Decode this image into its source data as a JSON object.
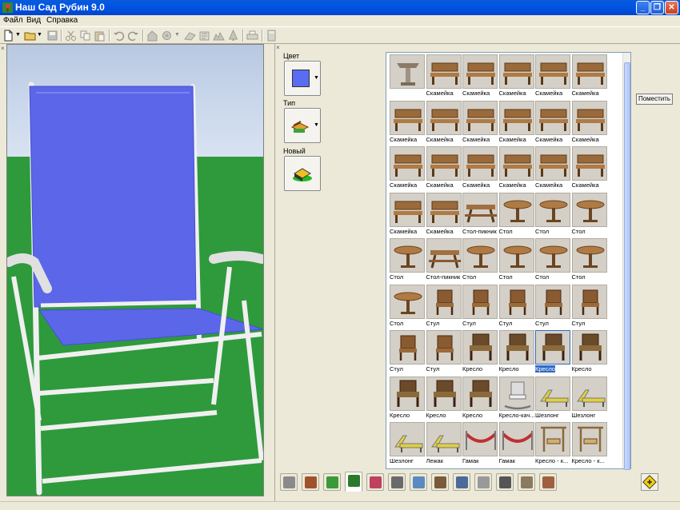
{
  "window": {
    "title": "Наш Сад Рубин 9.0",
    "app_icon": "garden-app-icon",
    "controls": [
      "minimize-icon",
      "restore-icon",
      "close-icon"
    ]
  },
  "menu": [
    "Файл",
    "Вид",
    "Справка"
  ],
  "toolbar": {
    "icons": [
      "new-document-icon",
      "open-folder-icon",
      "save-icon",
      "cut-icon",
      "copy-icon",
      "paste-icon",
      "undo-icon",
      "redo-icon",
      "building-icon",
      "flower-icon",
      "path-icon",
      "fence-icon",
      "terrain-icon",
      "tree-icon",
      "print-icon",
      "calculator-icon"
    ]
  },
  "properties": {
    "color_label": "Цвет",
    "type_label": "Тип",
    "new_label": "Новый",
    "color_value": "#5a6cf0"
  },
  "gallery": {
    "items": [
      {
        "label": "",
        "icon": "birdbath"
      },
      {
        "label": "Скамейка",
        "icon": "bench"
      },
      {
        "label": "Скамейка",
        "icon": "bench"
      },
      {
        "label": "Скамейка",
        "icon": "bench"
      },
      {
        "label": "Скамейка",
        "icon": "bench"
      },
      {
        "label": "Скамейка",
        "icon": "bench"
      },
      {
        "label": "Скамейка",
        "icon": "bench"
      },
      {
        "label": "Скамейка",
        "icon": "bench"
      },
      {
        "label": "Скамейка",
        "icon": "bench"
      },
      {
        "label": "Скамейка",
        "icon": "bench"
      },
      {
        "label": "Скамейка",
        "icon": "bench"
      },
      {
        "label": "Скамейка",
        "icon": "bench"
      },
      {
        "label": "Скамейка",
        "icon": "bench"
      },
      {
        "label": "Скамейка",
        "icon": "bench"
      },
      {
        "label": "Скамейка",
        "icon": "bench"
      },
      {
        "label": "Скамейка",
        "icon": "bench"
      },
      {
        "label": "Скамейка",
        "icon": "bench"
      },
      {
        "label": "Скамейка",
        "icon": "bench"
      },
      {
        "label": "Скамейка",
        "icon": "bench"
      },
      {
        "label": "Скамейка",
        "icon": "bench"
      },
      {
        "label": "Стол-пикник",
        "icon": "picnic-table"
      },
      {
        "label": "Стол",
        "icon": "table"
      },
      {
        "label": "Стол",
        "icon": "table"
      },
      {
        "label": "Стол",
        "icon": "table"
      },
      {
        "label": "Стол",
        "icon": "table"
      },
      {
        "label": "Стол-пикник",
        "icon": "picnic-table"
      },
      {
        "label": "Стол",
        "icon": "table"
      },
      {
        "label": "Стол",
        "icon": "table"
      },
      {
        "label": "Стол",
        "icon": "table"
      },
      {
        "label": "Стол",
        "icon": "table"
      },
      {
        "label": "Стол",
        "icon": "table"
      },
      {
        "label": "Стул",
        "icon": "chair"
      },
      {
        "label": "Стул",
        "icon": "chair"
      },
      {
        "label": "Стул",
        "icon": "chair"
      },
      {
        "label": "Стул",
        "icon": "chair"
      },
      {
        "label": "Стул",
        "icon": "chair"
      },
      {
        "label": "Стул",
        "icon": "chair"
      },
      {
        "label": "Стул",
        "icon": "chair"
      },
      {
        "label": "Кресло",
        "icon": "armchair"
      },
      {
        "label": "Кресло",
        "icon": "armchair"
      },
      {
        "label": "Кресло",
        "icon": "armchair"
      },
      {
        "label": "Кресло",
        "icon": "armchair"
      },
      {
        "label": "Кресло",
        "icon": "armchair"
      },
      {
        "label": "Кресло",
        "icon": "armchair"
      },
      {
        "label": "Кресло",
        "icon": "armchair"
      },
      {
        "label": "Кресло-кач...",
        "icon": "rocking-chair"
      },
      {
        "label": "Шезлонг",
        "icon": "lounger"
      },
      {
        "label": "Шезлонг",
        "icon": "lounger"
      },
      {
        "label": "Шезлонг",
        "icon": "lounger"
      },
      {
        "label": "Лежак",
        "icon": "lounger"
      },
      {
        "label": "Гамак",
        "icon": "hammock"
      },
      {
        "label": "Гамак",
        "icon": "hammock"
      },
      {
        "label": "Кресло - к...",
        "icon": "swing"
      },
      {
        "label": "Кресло - к...",
        "icon": "swing"
      }
    ],
    "selected_index": 40
  },
  "place_button": "Поместить",
  "bottom_tabs": [
    "elevation-tab-icon",
    "house-tab-icon",
    "furniture-tab-icon",
    "tree-tab-icon",
    "flowers-tab-icon",
    "stone-tab-icon",
    "pond-tab-icon",
    "fence-tab-icon",
    "window-tab-icon",
    "notes-tab-icon",
    "tools-tab-icon",
    "bridge-tab-icon",
    "wall-tab-icon"
  ],
  "active_tab": 3
}
